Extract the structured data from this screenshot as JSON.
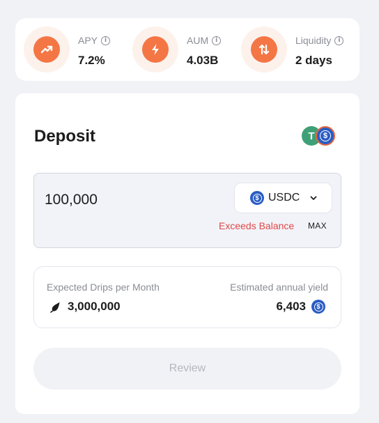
{
  "stats": [
    {
      "label": "APY",
      "value": "7.2%",
      "icon": "trend-up-icon"
    },
    {
      "label": "AUM",
      "value": "4.03B",
      "icon": "lightning-icon"
    },
    {
      "label": "Liquidity",
      "value": "2 days",
      "icon": "swap-arrows-icon"
    }
  ],
  "deposit": {
    "title": "Deposit",
    "tokens": [
      "USDT",
      "USDC"
    ],
    "amount": "100,000",
    "selected_token": "USDC",
    "error": "Exceeds Balance",
    "max_label": "MAX"
  },
  "summary": {
    "drips_label": "Expected Drips per Month",
    "drips_value": "3,000,000",
    "yield_label": "Estimated annual yield",
    "yield_value": "6,403"
  },
  "review_label": "Review",
  "colors": {
    "accent": "#f47645",
    "error": "#e04848",
    "usdc": "#2a5dc4",
    "usdt": "#3fa077"
  }
}
